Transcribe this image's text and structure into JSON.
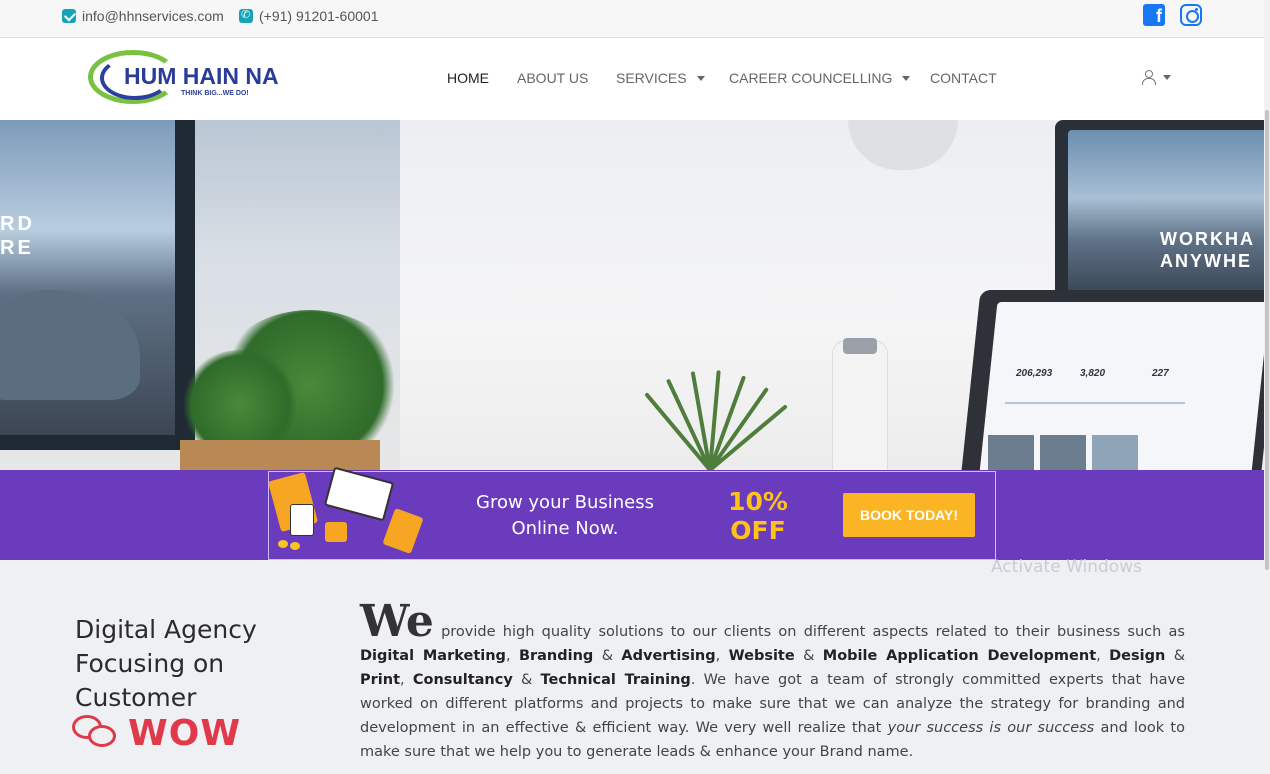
{
  "topbar": {
    "email": "info@hhnservices.com",
    "phone": "(+91) 91201-60001",
    "email_icon": "envelope-icon",
    "phone_icon": "phone-icon",
    "social": [
      "facebook-icon",
      "instagram-icon"
    ],
    "accent": "#1877f2"
  },
  "header": {
    "logo_text": "HUM HAIN NA",
    "logo_tagline": "THINK BIG...WE DO!",
    "nav": [
      {
        "label": "HOME",
        "active": true
      },
      {
        "label": "ABOUT US"
      },
      {
        "label": "SERVICES",
        "dropdown": true
      },
      {
        "label": "CAREER COUNCELLING",
        "dropdown": true
      },
      {
        "label": "CONTACT"
      }
    ],
    "user_icon": "user-icon"
  },
  "hero": {
    "left_screen_text": "RD\nRE",
    "right_screen_text": "WORKHA\nANYWHE",
    "laptop_stats": [
      "206,293",
      "3,820",
      "227"
    ]
  },
  "promo": {
    "text_line1": "Grow your Business",
    "text_line2": "Online Now.",
    "off_line1": "10%",
    "off_line2": "OFF",
    "button": "BOOK TODAY!",
    "band_color": "#6a3bbd",
    "off_color": "#ffc21a",
    "button_color": "#fbb524"
  },
  "watermark": "Activate Windows",
  "about": {
    "heading": "Digital Agency Focusing on Customer",
    "wow": "WOW",
    "big_word": "We",
    "p1": " provide high quality solutions to our clients on different aspects related to their business such as ",
    "s1": "Digital Marketing",
    "c1": ", ",
    "s2": "Branding",
    "c2": " & ",
    "s3": "Advertising",
    "c3": ", ",
    "s4": "Website",
    "c4": " & ",
    "s5": "Mobile Application Development",
    "c5": ", ",
    "s6": "Design",
    "c6": " & ",
    "s7": "Print",
    "c7": ", ",
    "s8": "Consultancy",
    "c8": " & ",
    "s9": "Technical Training",
    "p2": ". We have got a team of strongly committed experts that have worked on different platforms and projects to make sure that we can analyze the strategy for branding and development in an effective & efficient way. We very well realize that ",
    "em": "your success is our success",
    "p3": " and look to make sure that we help you to generate leads & enhance your Brand name.",
    "wow_color": "#e03a4a"
  }
}
